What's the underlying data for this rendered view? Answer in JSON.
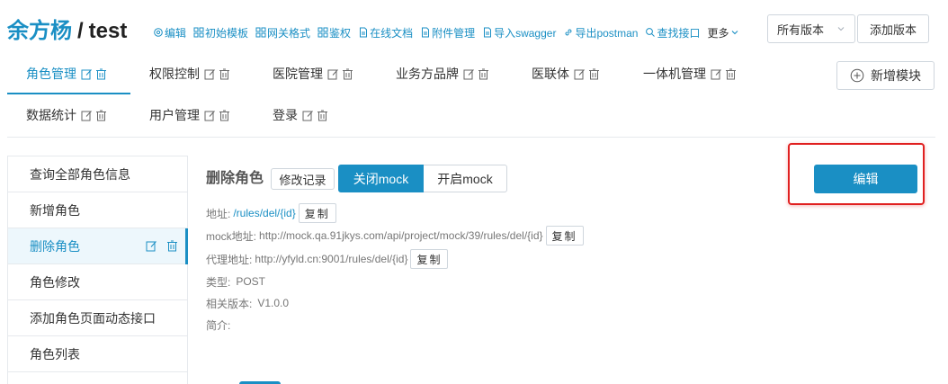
{
  "header": {
    "owner": "余方杨",
    "separator": "/",
    "project": "test",
    "toolbar": [
      {
        "label": "编辑",
        "icon": "gear-icon"
      },
      {
        "label": "初始模板",
        "icon": "grid-icon"
      },
      {
        "label": "网关格式",
        "icon": "grid-icon"
      },
      {
        "label": "鉴权",
        "icon": "grid-icon"
      },
      {
        "label": "在线文档",
        "icon": "document-icon"
      },
      {
        "label": "附件管理",
        "icon": "document-icon"
      },
      {
        "label": "导入swagger",
        "icon": "document-icon"
      },
      {
        "label": "导出postman",
        "icon": "link-icon"
      },
      {
        "label": "查找接口",
        "icon": "search-icon"
      },
      {
        "label": "更多",
        "icon": "chevron-down-icon"
      }
    ],
    "version_select": "所有版本",
    "add_version": "添加版本"
  },
  "modules": {
    "tabs": [
      "角色管理",
      "权限控制",
      "医院管理",
      "业务方品牌",
      "医联体",
      "一体机管理",
      "数据统计",
      "用户管理",
      "登录"
    ],
    "active_index": 0,
    "add_module": "新增模块"
  },
  "sidebar": {
    "items": [
      "查询全部角色信息",
      "新增角色",
      "删除角色",
      "角色修改",
      "添加角色页面动态接口",
      "角色列表"
    ],
    "active_index": 2
  },
  "detail": {
    "api_name": "删除角色",
    "history_button": "修改记录",
    "mock_off": "关闭mock",
    "mock_on": "开启mock",
    "address_label": "地址:",
    "address_value": "/rules/del/{id}",
    "mock_address_label": "mock地址:",
    "mock_address_value": "http://mock.qa.91jkys.com/api/project/mock/39/rules/del/{id}",
    "proxy_address_label": "代理地址:",
    "proxy_address_value": "http://yfyld.cn:9001/rules/del/{id}",
    "type_label": "类型:",
    "type_value": "POST",
    "version_label": "相关版本:",
    "version_value": "V1.0.0",
    "intro_label": "简介:",
    "copy_label": "复制",
    "edit_button": "编辑"
  },
  "colors": {
    "accent": "#1a8fc4",
    "highlight": "#e02020"
  }
}
